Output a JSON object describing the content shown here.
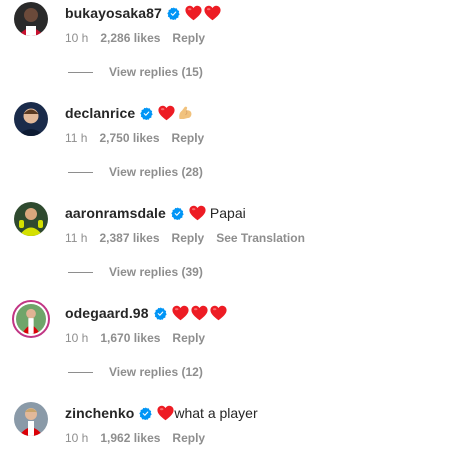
{
  "colors": {
    "verified": "#0095f6",
    "heart": "#ed1c24",
    "muted": "#8e8e8e",
    "text": "#262626",
    "story_ring": "#c13584"
  },
  "comments": [
    {
      "username": "bukayosaka87",
      "verified": true,
      "text": "",
      "emojis": [
        "red-heart",
        "red-heart"
      ],
      "time": "10 h",
      "likes": "2,286 likes",
      "reply": "Reply",
      "view_replies": "View replies (15)"
    },
    {
      "username": "declanrice",
      "verified": true,
      "text": "",
      "emojis": [
        "red-heart",
        "flexed-biceps"
      ],
      "time": "11 h",
      "likes": "2,750 likes",
      "reply": "Reply",
      "view_replies": "View replies (28)"
    },
    {
      "username": "aaronramsdale",
      "verified": true,
      "text": "Papai",
      "emojis": [
        "red-heart"
      ],
      "time": "11 h",
      "likes": "2,387 likes",
      "reply": "Reply",
      "see_translation": "See Translation",
      "view_replies": "View replies (39)"
    },
    {
      "username": "odegaard.98",
      "verified": true,
      "text": "",
      "emojis": [
        "red-heart",
        "red-heart",
        "red-heart"
      ],
      "time": "10 h",
      "likes": "1,670 likes",
      "reply": "Reply",
      "view_replies": "View replies (12)",
      "has_story": true
    },
    {
      "username": "zinchenko",
      "verified": true,
      "text": "what a player",
      "emojis": [
        "red-heart"
      ],
      "time": "10 h",
      "likes": "1,962 likes",
      "reply": "Reply"
    }
  ]
}
